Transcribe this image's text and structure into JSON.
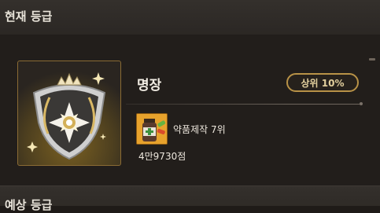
{
  "header": {
    "title": "현재 등급"
  },
  "grade": {
    "name": "명장",
    "rank_badge": "상위 10%",
    "emblem_icon": "star-crest-emblem-icon",
    "accent_color": "#b89247"
  },
  "item": {
    "icon": "medicine-bottle-icon",
    "label": "약품제작 7위"
  },
  "score": "4만9730점",
  "footer": {
    "title": "예상 등급"
  }
}
